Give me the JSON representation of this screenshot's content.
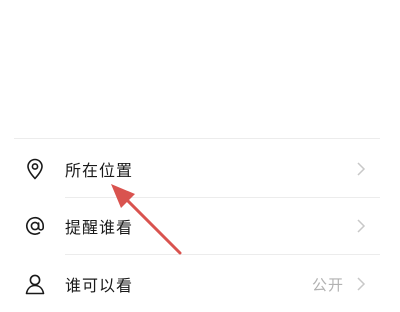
{
  "options": [
    {
      "label": "所在位置",
      "value": "",
      "icon": "location-pin-icon"
    },
    {
      "label": "提醒谁看",
      "value": "",
      "icon": "at-sign-icon"
    },
    {
      "label": "谁可以看",
      "value": "公开",
      "icon": "person-icon"
    }
  ],
  "colors": {
    "label": "#1a1a1a",
    "value": "#b2b2b2",
    "chevron": "#c8c8c8",
    "divider": "#ececec",
    "annotation_arrow": "#d9534f"
  }
}
